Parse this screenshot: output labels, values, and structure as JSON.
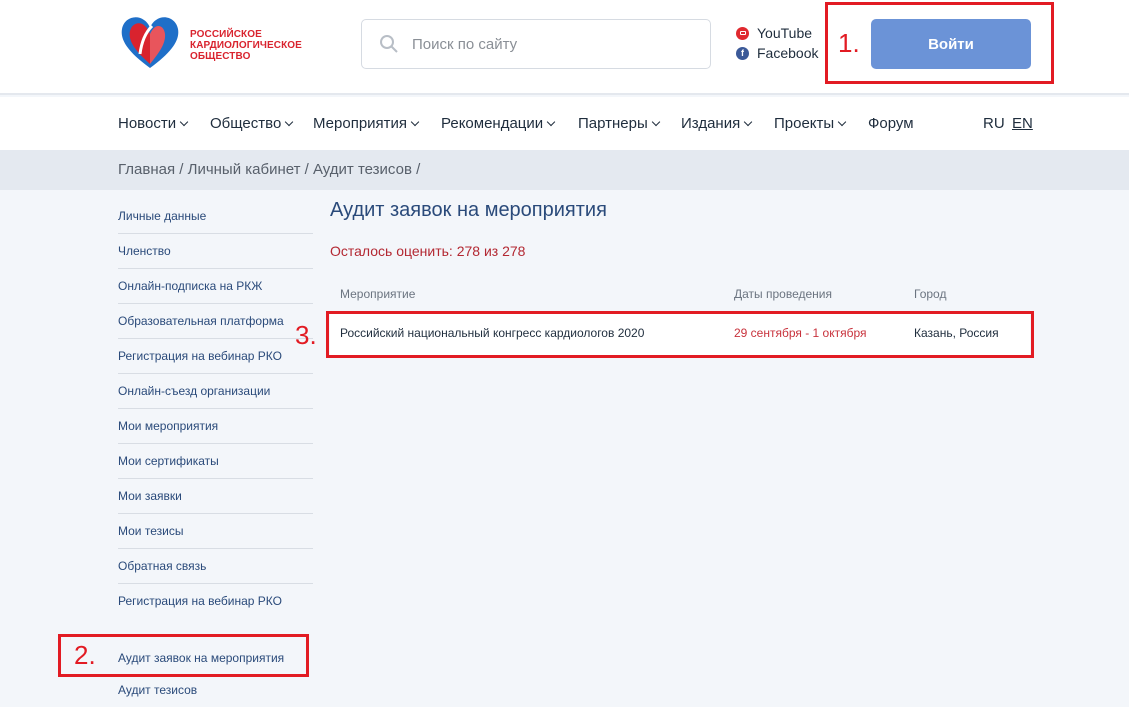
{
  "logo": {
    "line1": "РОССИЙСКОЕ",
    "line2": "КАРДИОЛОГИЧЕСКОЕ",
    "line3": "ОБЩЕСТВО",
    "colors": {
      "red": "#d9232e",
      "blue": "#1f6fc8"
    }
  },
  "search": {
    "placeholder": "Поиск по сайту",
    "icon": "search-icon"
  },
  "social": {
    "youtube": "YouTube",
    "facebook": "Facebook"
  },
  "login": {
    "label": "Войти"
  },
  "nav": {
    "items": [
      {
        "label": "Новости",
        "has_dropdown": true
      },
      {
        "label": "Общество",
        "has_dropdown": true
      },
      {
        "label": "Мероприятия",
        "has_dropdown": true
      },
      {
        "label": "Рекомендации",
        "has_dropdown": true
      },
      {
        "label": "Партнеры",
        "has_dropdown": true
      },
      {
        "label": "Издания",
        "has_dropdown": true
      },
      {
        "label": "Проекты",
        "has_dropdown": true
      },
      {
        "label": "Форум",
        "has_dropdown": false
      }
    ],
    "lang_ru": "RU",
    "lang_en": "EN"
  },
  "breadcrumb": "Главная / Личный кабинет / Аудит тезисов /",
  "sidebar": {
    "items": [
      "Личные данные",
      "Членство",
      "Онлайн-подписка на РКЖ",
      "Образовательная платформа",
      "Регистрация на вебинар РКО",
      "Онлайн-съезд организации",
      "Мои мероприятия",
      "Мои сертификаты",
      "Мои заявки",
      "Мои тезисы",
      "Обратная связь",
      "Регистрация на вебинар РКО"
    ],
    "active": "Аудит заявок на мероприятия",
    "last": "Аудит тезисов"
  },
  "main": {
    "title": "Аудит заявок на мероприятия",
    "remaining": "Осталось оценить: 278 из 278",
    "columns": [
      "Мероприятие",
      "Даты проведения",
      "Город"
    ],
    "rows": [
      {
        "event": "Российский национальный конгресс кардиологов 2020",
        "dates": "29 сентября - 1 октября",
        "city": "Казань, Россия"
      }
    ]
  },
  "annotations": {
    "one": "1.",
    "two": "2.",
    "three": "3.",
    "color": "#e21b23"
  }
}
